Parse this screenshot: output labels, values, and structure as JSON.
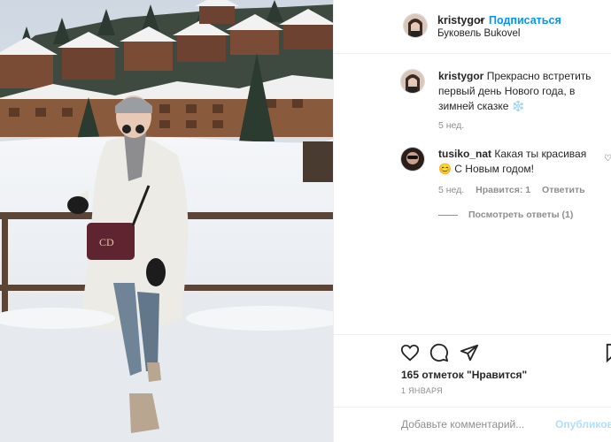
{
  "post": {
    "author": "kristygor",
    "follow_label": "Подписаться",
    "location": "Буковель Bukovel"
  },
  "caption": {
    "username": "kristygor",
    "text": "Прекрасно встретить первый день Нового года, в зимней сказке ❄️",
    "age": "5 нед."
  },
  "comments": [
    {
      "username": "tusiko_nat",
      "text": "Какая ты красивая😊 С Новым годом!",
      "age": "5 нед.",
      "likes": "Нравится: 1",
      "reply_label": "Ответить",
      "view_replies": "Посмотреть ответы (1)"
    }
  ],
  "actions": {
    "likes_text": "165 отметок \"Нравится\"",
    "date": "1 ЯНВАРЯ",
    "icons": [
      "heart-icon",
      "comment-icon",
      "share-icon",
      "bookmark-icon"
    ]
  },
  "add_comment": {
    "placeholder": "Добавьте комментарий...",
    "post_label": "Опубликовать"
  },
  "colors": {
    "link_blue": "#0095f6",
    "disabled_blue": "#b2dffc",
    "muted": "#8e8e8e",
    "text": "#262626"
  }
}
